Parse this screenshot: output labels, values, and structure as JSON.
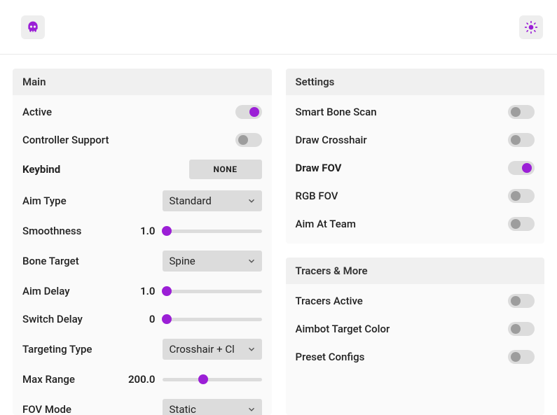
{
  "colors": {
    "accent": "#9b1fd6"
  },
  "header": {
    "logo_icon": "skull-icon",
    "theme_icon": "brightness-icon"
  },
  "main_panel": {
    "title": "Main",
    "active_label": "Active",
    "active_on": true,
    "controller_label": "Controller Support",
    "controller_on": false,
    "keybind_label": "Keybind",
    "keybind_value": "NONE",
    "aim_type_label": "Aim Type",
    "aim_type_value": "Standard",
    "smoothness_label": "Smoothness",
    "smoothness_value": "1.0",
    "bone_target_label": "Bone Target",
    "bone_target_value": "Spine",
    "aim_delay_label": "Aim Delay",
    "aim_delay_value": "1.0",
    "switch_delay_label": "Switch Delay",
    "switch_delay_value": "0",
    "targeting_type_label": "Targeting Type",
    "targeting_type_value": "Crosshair + Cl",
    "max_range_label": "Max Range",
    "max_range_value": "200.0",
    "fov_mode_label": "FOV Mode",
    "fov_mode_value": "Static"
  },
  "settings_panel": {
    "title": "Settings",
    "smart_bone_label": "Smart Bone Scan",
    "smart_bone_on": false,
    "draw_crosshair_label": "Draw Crosshair",
    "draw_crosshair_on": false,
    "draw_fov_label": "Draw FOV",
    "draw_fov_on": true,
    "rgb_fov_label": "RGB FOV",
    "rgb_fov_on": false,
    "aim_team_label": "Aim At Team",
    "aim_team_on": false
  },
  "tracers_panel": {
    "title": "Tracers & More",
    "tracers_active_label": "Tracers Active",
    "tracers_active_on": false,
    "aimbot_color_label": "Aimbot Target Color",
    "aimbot_color_on": false,
    "preset_label": "Preset Configs",
    "preset_on": false
  }
}
